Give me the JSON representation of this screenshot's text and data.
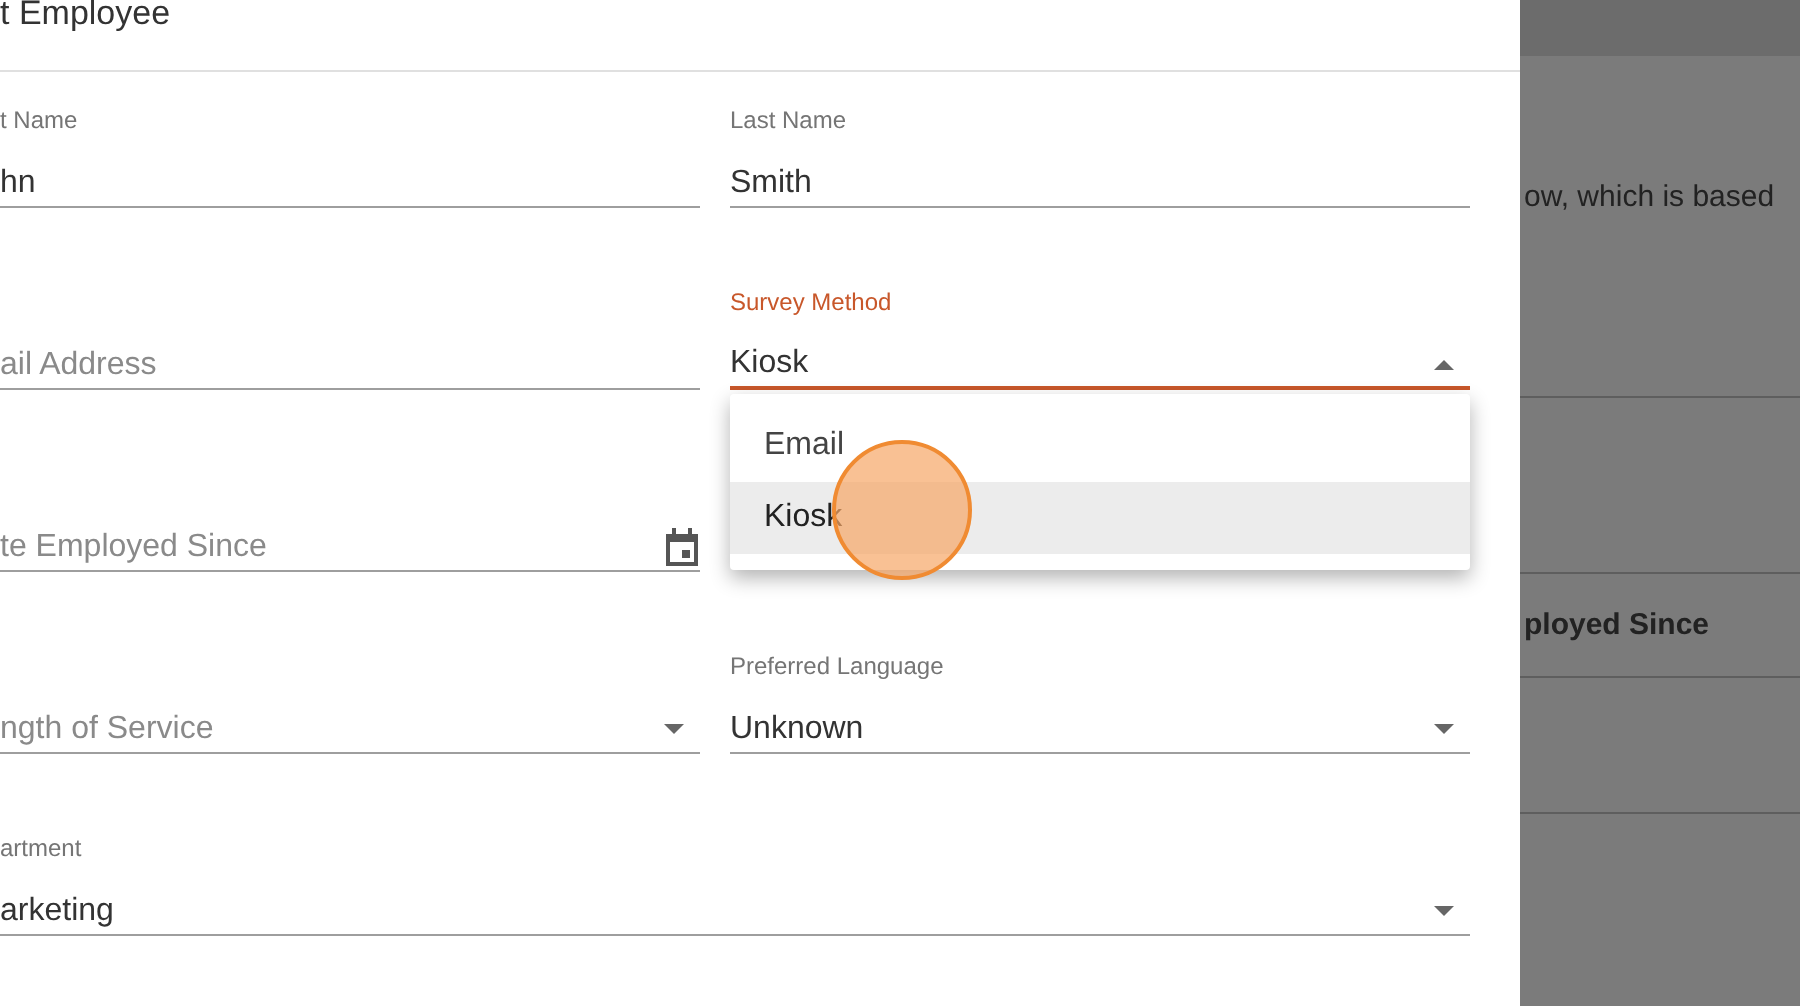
{
  "dialog": {
    "title": "t Employee",
    "rows": [
      [
        {
          "kind": "text",
          "label": "t Name",
          "value": "hn",
          "focused": false
        },
        {
          "kind": "text",
          "label": "Last Name",
          "value": "Smith",
          "focused": false
        }
      ],
      [
        {
          "kind": "text",
          "placeholder": "ail Address",
          "focused": false
        },
        {
          "kind": "select",
          "label": "Survey Method",
          "value": "Kiosk",
          "focused": true,
          "menu": [
            {
              "label": "Email",
              "selected": false
            },
            {
              "label": "Kiosk",
              "selected": true
            }
          ]
        }
      ],
      [
        {
          "kind": "date",
          "placeholder": "te Employed Since",
          "focused": false
        }
      ],
      [
        {
          "kind": "select",
          "placeholder": "ngth of Service",
          "focused": false
        },
        {
          "kind": "select",
          "label": "Preferred Language",
          "value": "Unknown",
          "focused": false
        }
      ],
      [
        {
          "kind": "select",
          "label": "artment",
          "value": "arketing",
          "focused": false
        }
      ]
    ]
  },
  "background": {
    "texts": [
      {
        "text": "ow, which is based",
        "bold": false
      },
      {
        "text": "ployed Since",
        "bold": true
      }
    ]
  }
}
